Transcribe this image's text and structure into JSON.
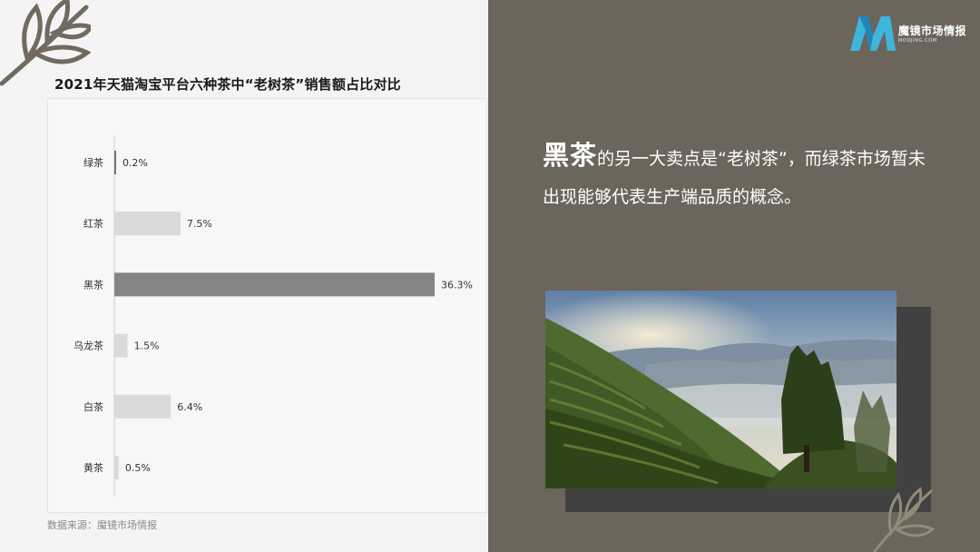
{
  "brand": {
    "name": "魔镜市场情报",
    "sub": "MOOJING.COM"
  },
  "headline": {
    "highlight": "黑茶",
    "text": "的另一大卖点是“老树茶”，而绿茶市场暂未出现能够代表生产端品质的概念。"
  },
  "source": "数据来源：魔镜市场情报",
  "photo": {
    "icon": "tea-plantation-landscape"
  },
  "colors": {
    "bar_highlight": "#858585",
    "bar_normal": "#dadada",
    "right_bg": "#6b655c"
  },
  "chart_data": {
    "type": "bar",
    "orientation": "horizontal",
    "title": "2021年天猫淘宝平台六种茶中“老树茶”销售额占比对比",
    "categories": [
      "绿茶",
      "红茶",
      "黑茶",
      "乌龙茶",
      "白茶",
      "黄茶"
    ],
    "values": [
      0.2,
      7.5,
      36.3,
      1.5,
      6.4,
      0.5
    ],
    "value_labels": [
      "0.2%",
      "7.5%",
      "36.3%",
      "1.5%",
      "6.4%",
      "0.5%"
    ],
    "highlight_index": 2,
    "xlim": [
      0,
      36.3
    ],
    "grid": false,
    "legend": "none"
  }
}
